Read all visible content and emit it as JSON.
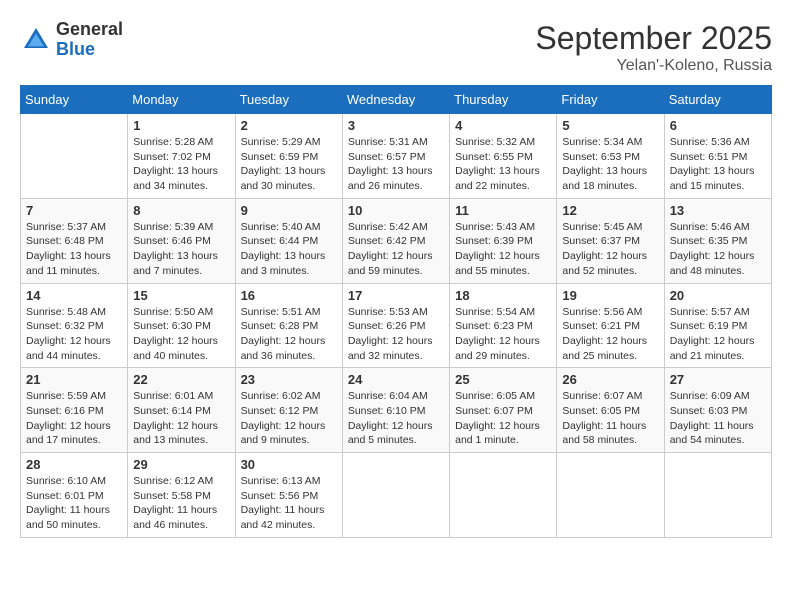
{
  "logo": {
    "general": "General",
    "blue": "Blue"
  },
  "header": {
    "month": "September 2025",
    "location": "Yelan'-Koleno, Russia"
  },
  "weekdays": [
    "Sunday",
    "Monday",
    "Tuesday",
    "Wednesday",
    "Thursday",
    "Friday",
    "Saturday"
  ],
  "weeks": [
    [
      {
        "day": "",
        "info": ""
      },
      {
        "day": "1",
        "info": "Sunrise: 5:28 AM\nSunset: 7:02 PM\nDaylight: 13 hours\nand 34 minutes."
      },
      {
        "day": "2",
        "info": "Sunrise: 5:29 AM\nSunset: 6:59 PM\nDaylight: 13 hours\nand 30 minutes."
      },
      {
        "day": "3",
        "info": "Sunrise: 5:31 AM\nSunset: 6:57 PM\nDaylight: 13 hours\nand 26 minutes."
      },
      {
        "day": "4",
        "info": "Sunrise: 5:32 AM\nSunset: 6:55 PM\nDaylight: 13 hours\nand 22 minutes."
      },
      {
        "day": "5",
        "info": "Sunrise: 5:34 AM\nSunset: 6:53 PM\nDaylight: 13 hours\nand 18 minutes."
      },
      {
        "day": "6",
        "info": "Sunrise: 5:36 AM\nSunset: 6:51 PM\nDaylight: 13 hours\nand 15 minutes."
      }
    ],
    [
      {
        "day": "7",
        "info": "Sunrise: 5:37 AM\nSunset: 6:48 PM\nDaylight: 13 hours\nand 11 minutes."
      },
      {
        "day": "8",
        "info": "Sunrise: 5:39 AM\nSunset: 6:46 PM\nDaylight: 13 hours\nand 7 minutes."
      },
      {
        "day": "9",
        "info": "Sunrise: 5:40 AM\nSunset: 6:44 PM\nDaylight: 13 hours\nand 3 minutes."
      },
      {
        "day": "10",
        "info": "Sunrise: 5:42 AM\nSunset: 6:42 PM\nDaylight: 12 hours\nand 59 minutes."
      },
      {
        "day": "11",
        "info": "Sunrise: 5:43 AM\nSunset: 6:39 PM\nDaylight: 12 hours\nand 55 minutes."
      },
      {
        "day": "12",
        "info": "Sunrise: 5:45 AM\nSunset: 6:37 PM\nDaylight: 12 hours\nand 52 minutes."
      },
      {
        "day": "13",
        "info": "Sunrise: 5:46 AM\nSunset: 6:35 PM\nDaylight: 12 hours\nand 48 minutes."
      }
    ],
    [
      {
        "day": "14",
        "info": "Sunrise: 5:48 AM\nSunset: 6:32 PM\nDaylight: 12 hours\nand 44 minutes."
      },
      {
        "day": "15",
        "info": "Sunrise: 5:50 AM\nSunset: 6:30 PM\nDaylight: 12 hours\nand 40 minutes."
      },
      {
        "day": "16",
        "info": "Sunrise: 5:51 AM\nSunset: 6:28 PM\nDaylight: 12 hours\nand 36 minutes."
      },
      {
        "day": "17",
        "info": "Sunrise: 5:53 AM\nSunset: 6:26 PM\nDaylight: 12 hours\nand 32 minutes."
      },
      {
        "day": "18",
        "info": "Sunrise: 5:54 AM\nSunset: 6:23 PM\nDaylight: 12 hours\nand 29 minutes."
      },
      {
        "day": "19",
        "info": "Sunrise: 5:56 AM\nSunset: 6:21 PM\nDaylight: 12 hours\nand 25 minutes."
      },
      {
        "day": "20",
        "info": "Sunrise: 5:57 AM\nSunset: 6:19 PM\nDaylight: 12 hours\nand 21 minutes."
      }
    ],
    [
      {
        "day": "21",
        "info": "Sunrise: 5:59 AM\nSunset: 6:16 PM\nDaylight: 12 hours\nand 17 minutes."
      },
      {
        "day": "22",
        "info": "Sunrise: 6:01 AM\nSunset: 6:14 PM\nDaylight: 12 hours\nand 13 minutes."
      },
      {
        "day": "23",
        "info": "Sunrise: 6:02 AM\nSunset: 6:12 PM\nDaylight: 12 hours\nand 9 minutes."
      },
      {
        "day": "24",
        "info": "Sunrise: 6:04 AM\nSunset: 6:10 PM\nDaylight: 12 hours\nand 5 minutes."
      },
      {
        "day": "25",
        "info": "Sunrise: 6:05 AM\nSunset: 6:07 PM\nDaylight: 12 hours\nand 1 minute."
      },
      {
        "day": "26",
        "info": "Sunrise: 6:07 AM\nSunset: 6:05 PM\nDaylight: 11 hours\nand 58 minutes."
      },
      {
        "day": "27",
        "info": "Sunrise: 6:09 AM\nSunset: 6:03 PM\nDaylight: 11 hours\nand 54 minutes."
      }
    ],
    [
      {
        "day": "28",
        "info": "Sunrise: 6:10 AM\nSunset: 6:01 PM\nDaylight: 11 hours\nand 50 minutes."
      },
      {
        "day": "29",
        "info": "Sunrise: 6:12 AM\nSunset: 5:58 PM\nDaylight: 11 hours\nand 46 minutes."
      },
      {
        "day": "30",
        "info": "Sunrise: 6:13 AM\nSunset: 5:56 PM\nDaylight: 11 hours\nand 42 minutes."
      },
      {
        "day": "",
        "info": ""
      },
      {
        "day": "",
        "info": ""
      },
      {
        "day": "",
        "info": ""
      },
      {
        "day": "",
        "info": ""
      }
    ]
  ]
}
